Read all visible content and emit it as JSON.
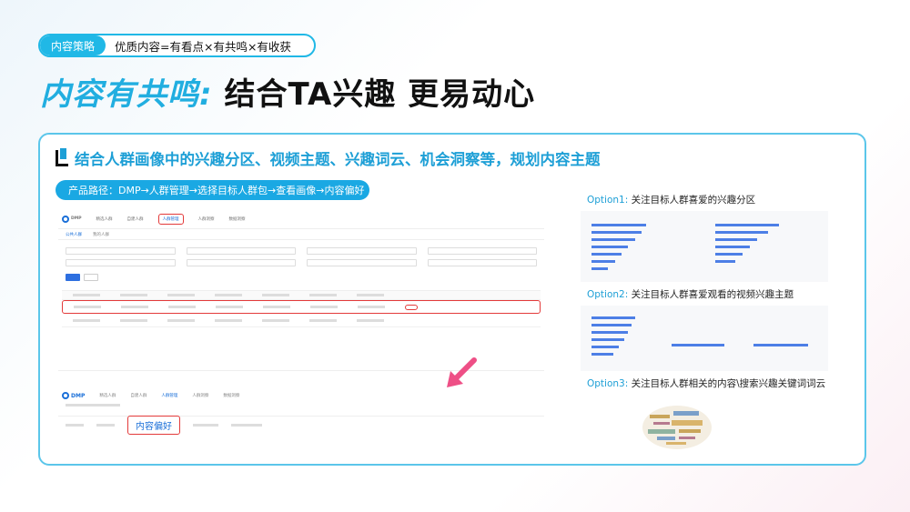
{
  "header": {
    "tag": "内容策略",
    "tagline": "优质内容=有看点×有共鸣×有收获",
    "headline_accent": "内容有共鸣:",
    "headline_rest": "结合TA兴趣 更易动心"
  },
  "card": {
    "title": "结合人群画像中的兴趣分区、视频主题、兴趣词云、机会洞察等，规划内容主题",
    "path": "产品路径：DMP→人群管理→选择目标人群包→查看画像→内容偏好"
  },
  "shot1": {
    "logo": "DMP",
    "nav": [
      "精选人群",
      "自建人群",
      "人群管理",
      "人群洞察",
      "数据洞察"
    ],
    "active_nav": "人群管理",
    "subtabs": [
      "公共人群",
      "我的人群"
    ]
  },
  "shot2": {
    "logo": "DMP",
    "nav": [
      "精选人群",
      "自建人群",
      "人群管理",
      "人群洞察",
      "数据洞察"
    ],
    "highlight": "内容偏好"
  },
  "options": [
    {
      "prefix": "Option1:",
      "text": "关注目标人群喜爱的兴趣分区"
    },
    {
      "prefix": "Option2:",
      "text": "关注目标人群喜爱观看的视频兴趣主题"
    },
    {
      "prefix": "Option3:",
      "text": "关注目标人群相关的内容\\搜索兴趣关键词词云"
    }
  ],
  "colors": {
    "accent": "#21aee0",
    "card_border": "#5bc6ea",
    "highlight_red": "#e33a3a",
    "bar_blue": "#4d7fe6"
  }
}
